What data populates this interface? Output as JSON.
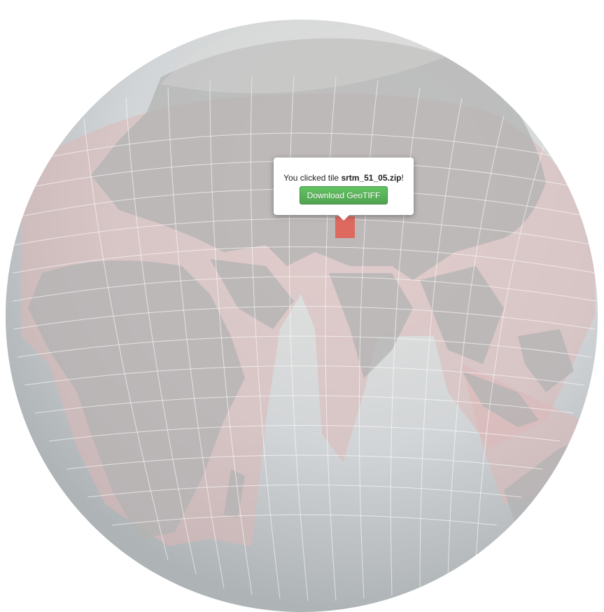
{
  "map": {
    "projection": "orthographic",
    "tile_set": "SRTM",
    "selected_tile": "srtm_51_05.zip",
    "colors": {
      "ocean": "#c9ced1",
      "land": "#b9b9b9",
      "tile_fill": "#e8c6c6",
      "selected_tile_fill": "#e06055",
      "grid_line": "#ffffff"
    }
  },
  "popup": {
    "text_prefix": "You clicked tile ",
    "tile_name": "srtm_51_05.zip",
    "text_suffix": "!",
    "button_label": "Download GeoTIFF"
  }
}
